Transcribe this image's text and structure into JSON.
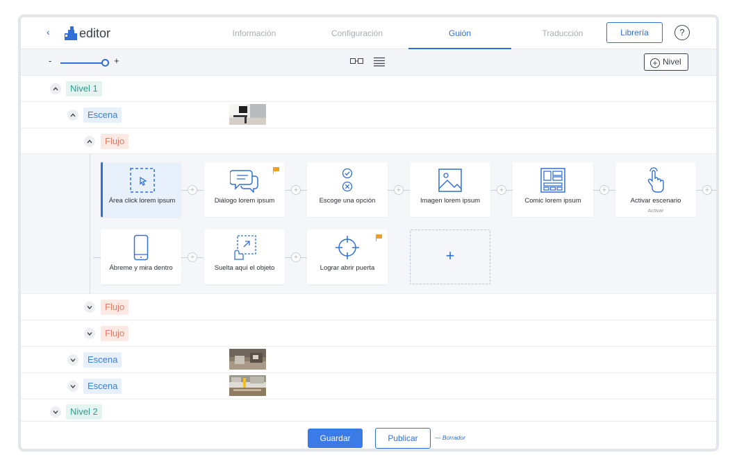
{
  "header": {
    "back_icon": "chevron-left-icon",
    "logo_text": "editor",
    "tabs": [
      {
        "label": "Información"
      },
      {
        "label": "Configuración"
      },
      {
        "label": "Guión"
      },
      {
        "label": "Traducción"
      }
    ],
    "active_tab": "Guión",
    "library_button": "Librería",
    "help_label": "?"
  },
  "toolbar": {
    "zoom_minus": "-",
    "zoom_plus": "+",
    "add_level_label": "Nivel"
  },
  "tree": {
    "nivel1": "Nivel 1",
    "escena1": "Escena",
    "flujo1": "Flujo",
    "flujo2": "Flujo",
    "flujo3": "Flujo",
    "escena2": "Escena",
    "escena3": "Escena",
    "nivel2": "Nivel 2"
  },
  "cards": [
    {
      "label": "Área click lorem ipsum",
      "icon": "cursor-area-icon",
      "selected": true
    },
    {
      "label": "Diálogo lorem ipsum",
      "icon": "chat-bubbles-icon",
      "flag": true
    },
    {
      "label": "Escoge una opción",
      "icon": "check-cross-icon"
    },
    {
      "label": "Imagen lorem ipsum",
      "icon": "image-icon"
    },
    {
      "label": "Comic lorem ipsum",
      "icon": "comic-layout-icon"
    },
    {
      "label": "Activar escenario",
      "sublabel": "Activar",
      "icon": "touch-hand-icon"
    },
    {
      "label": "Ábreme y mira dentro",
      "icon": "phone-icon"
    },
    {
      "label": "Suelta aquí el objeto",
      "icon": "drag-drop-icon"
    },
    {
      "label": "Lograr abrir puerta",
      "icon": "crosshair-icon",
      "flag": true
    }
  ],
  "add_card": "+",
  "connector_plus": "+",
  "footer": {
    "save_label": "Guardar",
    "publish_label": "Publicar",
    "status": "— Borrador"
  },
  "colors": {
    "accent": "#2f6fd6",
    "nivel": "#2e9a8a",
    "escena": "#3a7ed0",
    "flujo": "#e07a5f",
    "flag": "#f0a020"
  }
}
